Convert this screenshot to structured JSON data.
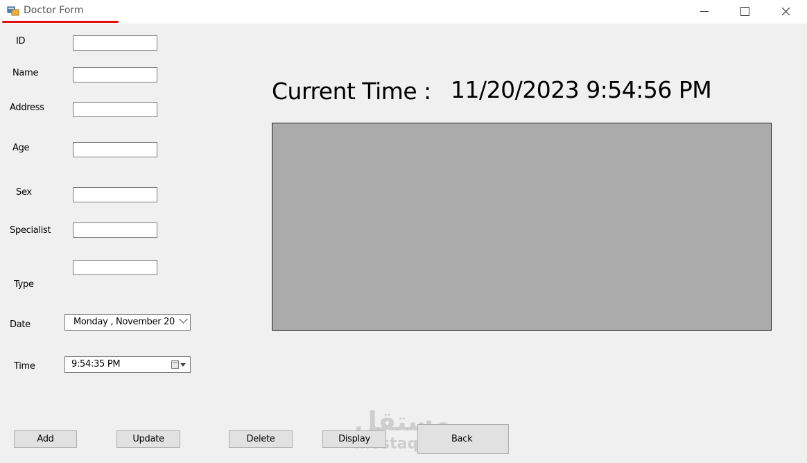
{
  "window": {
    "title": "Doctor Form",
    "controls": {
      "minimize": "minimize",
      "maximize": "maximize",
      "close": "close"
    }
  },
  "fields": [
    {
      "label": "ID",
      "value": ""
    },
    {
      "label": "Name",
      "value": ""
    },
    {
      "label": "Address",
      "value": ""
    },
    {
      "label": "Age",
      "value": ""
    },
    {
      "label": "Sex",
      "value": ""
    },
    {
      "label": "Specialist",
      "value": ""
    },
    {
      "label": "Type",
      "value": ""
    }
  ],
  "date": {
    "label": "Date",
    "value": "Monday   , November 20"
  },
  "time": {
    "label": "Time",
    "value": "9:54:35 PM"
  },
  "clock": {
    "label": "Current Time :",
    "value": "11/20/2023 9:54:56 PM"
  },
  "buttons": {
    "add": "Add",
    "update": "Update",
    "delete": "Delete",
    "display": "Display",
    "back": "Back"
  },
  "watermark": {
    "main": "مستقل",
    "sub": "mostaql.com"
  },
  "colors": {
    "accent_underline": "#e01010",
    "grid_background": "#ababab",
    "form_background": "#f0f0f0"
  },
  "icons": [
    "app-icon",
    "minimize-icon",
    "maximize-icon",
    "close-icon",
    "chevron-down-icon",
    "calendar-icon"
  ]
}
